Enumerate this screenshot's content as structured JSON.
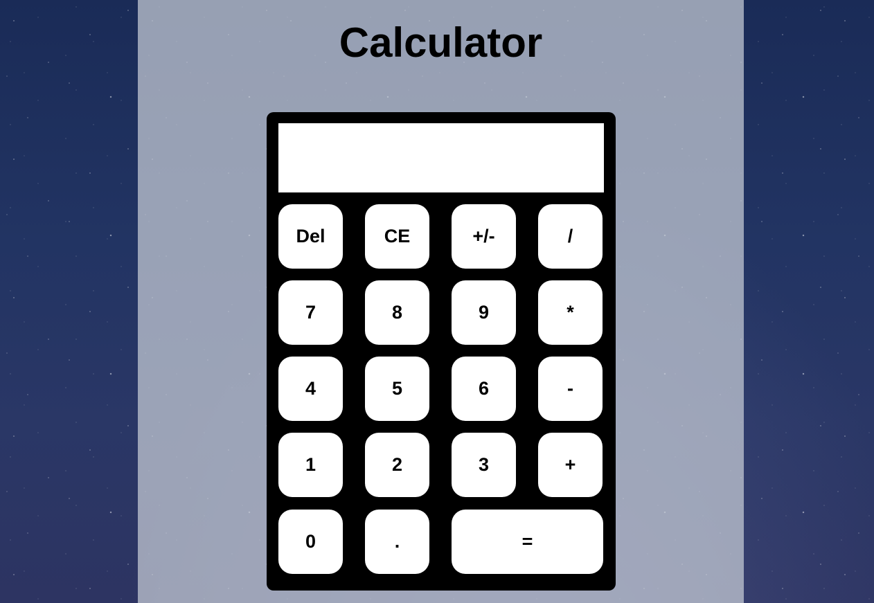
{
  "page": {
    "title": "Calculator"
  },
  "colors": {
    "calculator_body": "#000000",
    "key_background": "#ffffff",
    "panel_overlay": "#c8cdd7"
  },
  "display": {
    "value": ""
  },
  "keys": {
    "del": "Del",
    "ce": "CE",
    "plus_minus": "+/-",
    "divide": "/",
    "seven": "7",
    "eight": "8",
    "nine": "9",
    "multiply": "*",
    "four": "4",
    "five": "5",
    "six": "6",
    "minus": "-",
    "one": "1",
    "two": "2",
    "three": "3",
    "plus": "+",
    "zero": "0",
    "decimal": ".",
    "equals": "="
  }
}
